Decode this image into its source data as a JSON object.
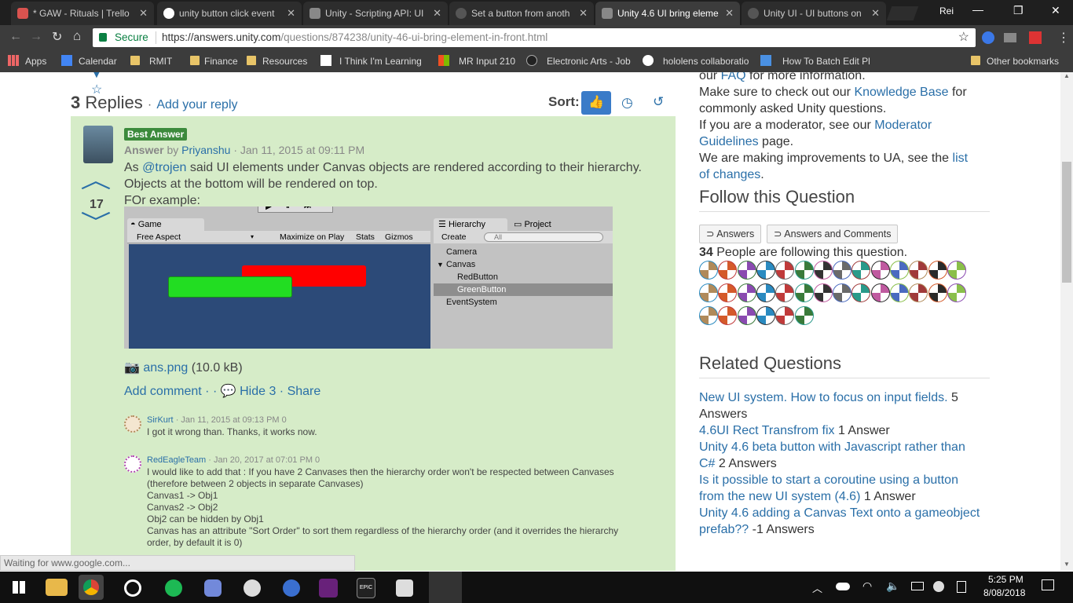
{
  "tabs": [
    {
      "label": "* GAW - Rituals | Trello",
      "fav": "#d9534f"
    },
    {
      "label": "unity button click event",
      "fav": "#ffffff"
    },
    {
      "label": "Unity - Scripting API: UI",
      "fav": "#888888"
    },
    {
      "label": "Set a button from anoth",
      "fav": "#555555"
    },
    {
      "label": "Unity 4.6 UI bring eleme",
      "fav": "#888888"
    },
    {
      "label": "Unity UI - UI buttons on",
      "fav": "#555555"
    }
  ],
  "profile_name": "Rei",
  "address": {
    "secure": "Secure",
    "url_host": "https://answers.unity.com",
    "url_path": "/questions/874238/unity-46-ui-bring-element-in-front.html"
  },
  "bookmarks": [
    "Apps",
    "Calendar",
    "RMIT",
    "Finance",
    "Resources",
    "I Think I'm Learning",
    "MR Input 210",
    "Electronic Arts - Job",
    "hololens collaboratio",
    "How To Batch Edit Pl",
    "Other bookmarks"
  ],
  "replies": {
    "count": "3",
    "label": "Replies",
    "add": "Add your reply",
    "sort": "Sort:"
  },
  "answer": {
    "badge": "Best Answer",
    "type": "Answer",
    "by": "by",
    "author": "Priyanshu",
    "date": "· Jan 11, 2015 at 09:11 PM",
    "votes": "17",
    "text1_pre": "As ",
    "text1_mention": "@trojen",
    "text1_post": " said UI elements under Canvas objects are rendered according to their hierarchy.",
    "text2": "Objects at the bottom will be rendered on top.",
    "text3": "FOr example:",
    "attach_name": "ans.png",
    "attach_size": "(10.0 kB)",
    "actions": {
      "add_comment": "Add comment ·",
      "hide": "Hide 3",
      "share": "· Share"
    }
  },
  "unity_editor": {
    "game_tab": "Game",
    "aspect": "Free Aspect",
    "maximize": "Maximize on Play",
    "stats": "Stats",
    "gizmos": "Gizmos",
    "hierarchy_tab": "Hierarchy",
    "project_tab": "Project",
    "create": "Create",
    "search_placeholder": "All",
    "items": [
      "Camera",
      "Canvas",
      "RedButton",
      "GreenButton",
      "EventSystem"
    ]
  },
  "comments": [
    {
      "author": "SirKurt",
      "date": "· Jan 11, 2015 at 09:13 PM",
      "votes": "0",
      "lines": [
        "I got it wrong than. Thanks, it works now."
      ]
    },
    {
      "author": "RedEagleTeam",
      "date": "· Jan 20, 2017 at 07:01 PM",
      "votes": "0",
      "lines": [
        "I would like to add that : If you have 2 Canvases then the hierarchy order won't be respected between Canvases",
        "(therefore between 2 objects in separate Canvases)",
        "Canvas1 -> Obj1",
        "Canvas2 -> Obj2",
        "Obj2 can be hidden by Obj1",
        "Canvas has an attribute \"Sort Order\" to sort them regardless of the hierarchy order (and it overrides the hierarchy",
        "order, by default it is 0)"
      ]
    }
  ],
  "sidebar": {
    "faq_pre": "our ",
    "faq": "FAQ",
    "faq_post": " for more information.",
    "kb_pre": "Make sure to check out our ",
    "kb": "Knowledge Base",
    "kb_post": " for",
    "kb2": "commonly asked Unity questions.",
    "mod_pre": "If you are a moderator, see our ",
    "mod": "Moderator",
    "mod2": "Guidelines",
    "mod_post": " page.",
    "imp_pre": "We are making improvements to UA, see the ",
    "imp": "list",
    "imp2": "of changes",
    "imp_post": ".",
    "follow_title": "Follow this Question",
    "btn_answers": "Answers",
    "btn_answers_comments": "Answers and Comments",
    "followers_count": "34",
    "followers_text": " People are following this question.",
    "related_title": "Related Questions",
    "related": [
      {
        "link": "New UI system. How to focus on input fields.",
        "suffix": " 5"
      },
      {
        "link": "",
        "suffix": "Answers"
      },
      {
        "link": "4.6UI Rect Transfrom fix",
        "suffix": " 1 Answer"
      },
      {
        "link": "Unity 4.6 beta button with Javascript rather than",
        "suffix": ""
      },
      {
        "link": "C#",
        "suffix": " 2 Answers"
      },
      {
        "link": "Is it possible to start a coroutine using a button",
        "suffix": ""
      },
      {
        "link": "from the new UI system (4.6)",
        "suffix": " 1 Answer"
      },
      {
        "link": "Unity 4.6 adding a Canvas Text onto a gameobject",
        "suffix": ""
      },
      {
        "link": "prefab??",
        "suffix": " -1 Answers"
      }
    ]
  },
  "status_text": "Waiting for www.google.com...",
  "clock": {
    "time": "5:25 PM",
    "date": "8/08/2018"
  },
  "colors": {
    "accent": "#2a6fa8",
    "answer_bg": "#d6ecc8",
    "badge": "#3c8a3c",
    "sort_active": "#3a7bc8"
  }
}
